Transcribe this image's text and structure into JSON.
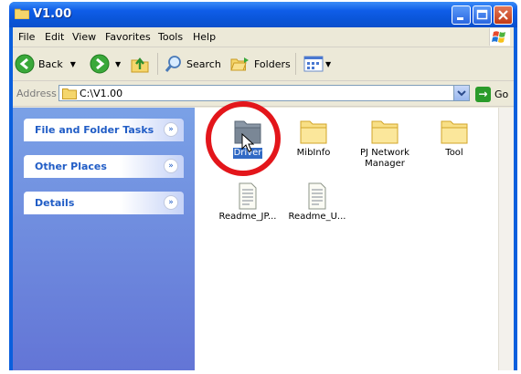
{
  "window": {
    "title": "V1.00"
  },
  "menu": [
    "File",
    "Edit",
    "View",
    "Favorites",
    "Tools",
    "Help"
  ],
  "toolbar": {
    "back_label": "Back",
    "search_label": "Search",
    "folders_label": "Folders"
  },
  "address": {
    "label": "Address",
    "value": "C:\\V1.00",
    "go_label": "Go"
  },
  "tasks": [
    {
      "label": "File and Folder Tasks",
      "chevron": "»"
    },
    {
      "label": "Other Places",
      "chevron": "»"
    },
    {
      "label": "Details",
      "chevron": "»"
    }
  ],
  "files": [
    {
      "name": "Driver",
      "icon": "folder-icon",
      "selected": true
    },
    {
      "name": "MibInfo",
      "icon": "folder-icon"
    },
    {
      "name": "PJ Network Manager",
      "icon": "folder-icon"
    },
    {
      "name": "Tool",
      "icon": "folder-icon"
    },
    {
      "name": "Readme_JP...",
      "icon": "text-file-icon"
    },
    {
      "name": "Readme_U...",
      "icon": "text-file-icon"
    }
  ],
  "colors": {
    "highlight_ring": "#e3161b",
    "selection": "#316ac5",
    "titlebar": "#0a55d8"
  }
}
